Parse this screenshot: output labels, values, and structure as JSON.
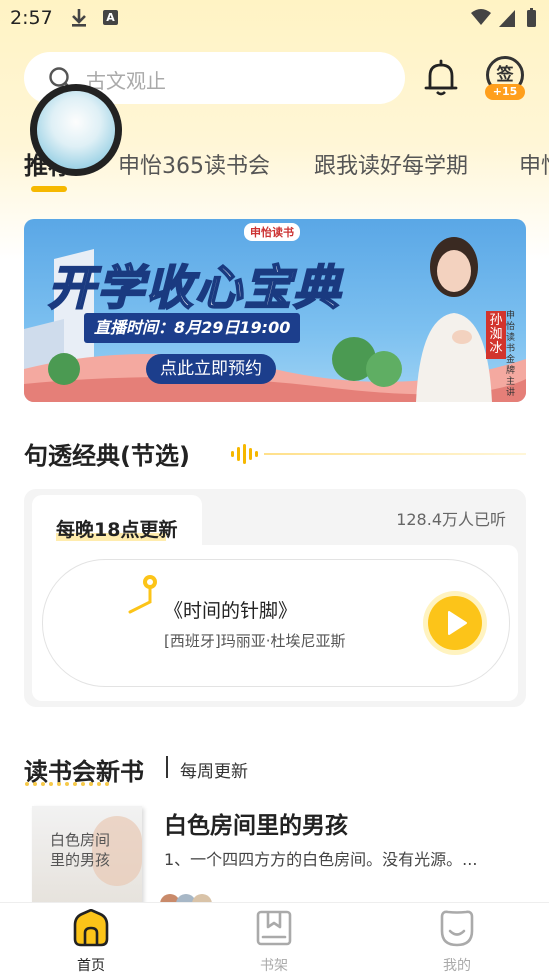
{
  "status_bar": {
    "time": "2:57",
    "a_icon": "A"
  },
  "search": {
    "placeholder": "古文观止"
  },
  "sign_in": {
    "char": "签",
    "bonus": "+15"
  },
  "tabs": [
    {
      "label": "推荐",
      "active": true
    },
    {
      "label": "申怡365读书会"
    },
    {
      "label": "跟我读好每学期"
    },
    {
      "label": "申怡"
    }
  ],
  "banner": {
    "logo": "申怡读书",
    "title": "开学收心宝典",
    "time": "直播时间：8月29日19:00",
    "button": "点此立即预约",
    "host_name": "孙洳冰",
    "host_role": "申怡读书金牌主讲"
  },
  "section_classics": {
    "title": "句透经典(节选)",
    "tab_label": "每晚18点更新",
    "listen_count": "128.4万人已听",
    "track_title": "《时间的针脚》",
    "track_author": "[西班牙]玛丽亚·杜埃尼亚斯"
  },
  "section_books": {
    "title": "读书会新书",
    "subtitle": "每周更新",
    "book_cover_text": "白色房间里的男孩",
    "book_title": "白色房间里的男孩",
    "book_desc": "1、一个四四方方的白色房间。没有光源。..."
  },
  "bottom_nav": [
    {
      "label": "首页",
      "icon": "home-icon",
      "active": true
    },
    {
      "label": "书架",
      "icon": "bookshelf-icon"
    },
    {
      "label": "我的",
      "icon": "profile-icon"
    }
  ],
  "colors": {
    "accent": "#fcc419",
    "banner_blue": "#1c3e8c"
  }
}
